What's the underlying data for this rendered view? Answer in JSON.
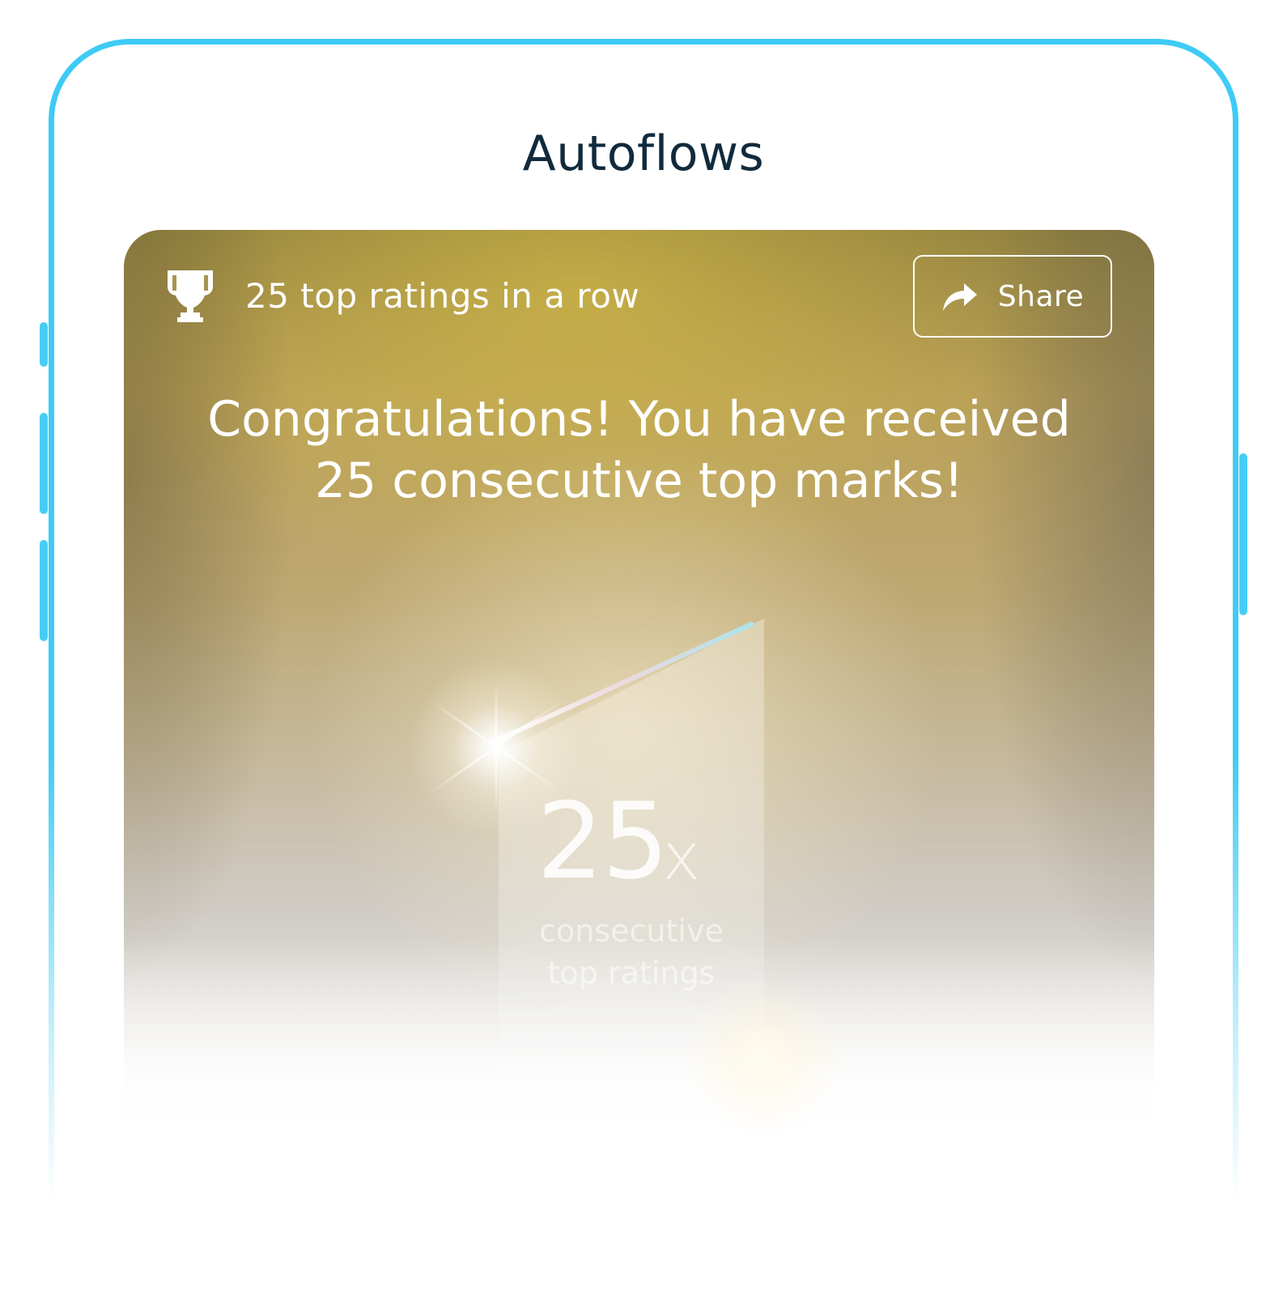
{
  "app": {
    "title": "Autoflows"
  },
  "achievement": {
    "badge_icon": "trophy-icon",
    "badge_label": "25 top ratings in a row",
    "share_button": {
      "icon": "share-arrow-icon",
      "label": "Share"
    },
    "headline_line1": "Congratulations! You have received",
    "headline_line2": "25 consecutive top marks!",
    "trophy": {
      "count": "25",
      "multiplier": "x",
      "caption_line1": "consecutive",
      "caption_line2": "top ratings"
    }
  },
  "colors": {
    "frame": "#3ecbf5",
    "title_text": "#112a3c",
    "card_gold": "#b79e58",
    "text_on_card": "#ffffff"
  }
}
